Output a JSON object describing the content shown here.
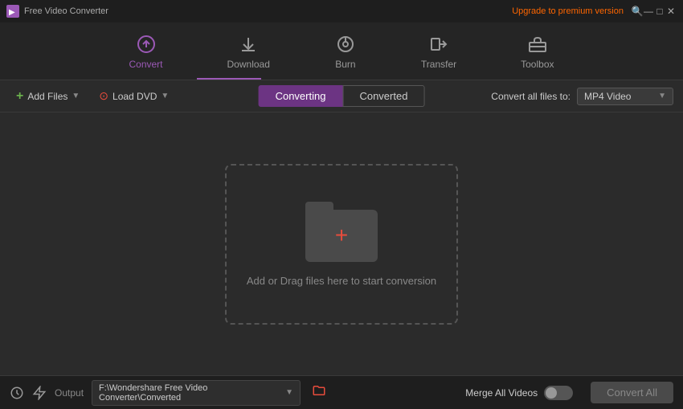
{
  "titlebar": {
    "app_name": "Free Video Converter",
    "upgrade_text": "Upgrade to premium version",
    "search_icon": "🔍",
    "minimize_icon": "—",
    "maximize_icon": "□",
    "close_icon": "✕"
  },
  "navbar": {
    "items": [
      {
        "id": "convert",
        "label": "Convert",
        "active": true
      },
      {
        "id": "download",
        "label": "Download",
        "active": false
      },
      {
        "id": "burn",
        "label": "Burn",
        "active": false
      },
      {
        "id": "transfer",
        "label": "Transfer",
        "active": false
      },
      {
        "id": "toolbox",
        "label": "Toolbox",
        "active": false
      }
    ]
  },
  "toolbar": {
    "add_files_label": "Add Files",
    "load_dvd_label": "Load DVD",
    "converting_tab": "Converting",
    "converted_tab": "Converted",
    "convert_all_label": "Convert all files to:",
    "format_value": "MP4 Video"
  },
  "main": {
    "drop_text": "Add or Drag files here to start conversion"
  },
  "statusbar": {
    "output_label": "Output",
    "output_path": "F:\\Wondershare Free Video Converter\\Converted",
    "merge_label": "Merge All Videos",
    "convert_all_btn": "Convert All"
  }
}
